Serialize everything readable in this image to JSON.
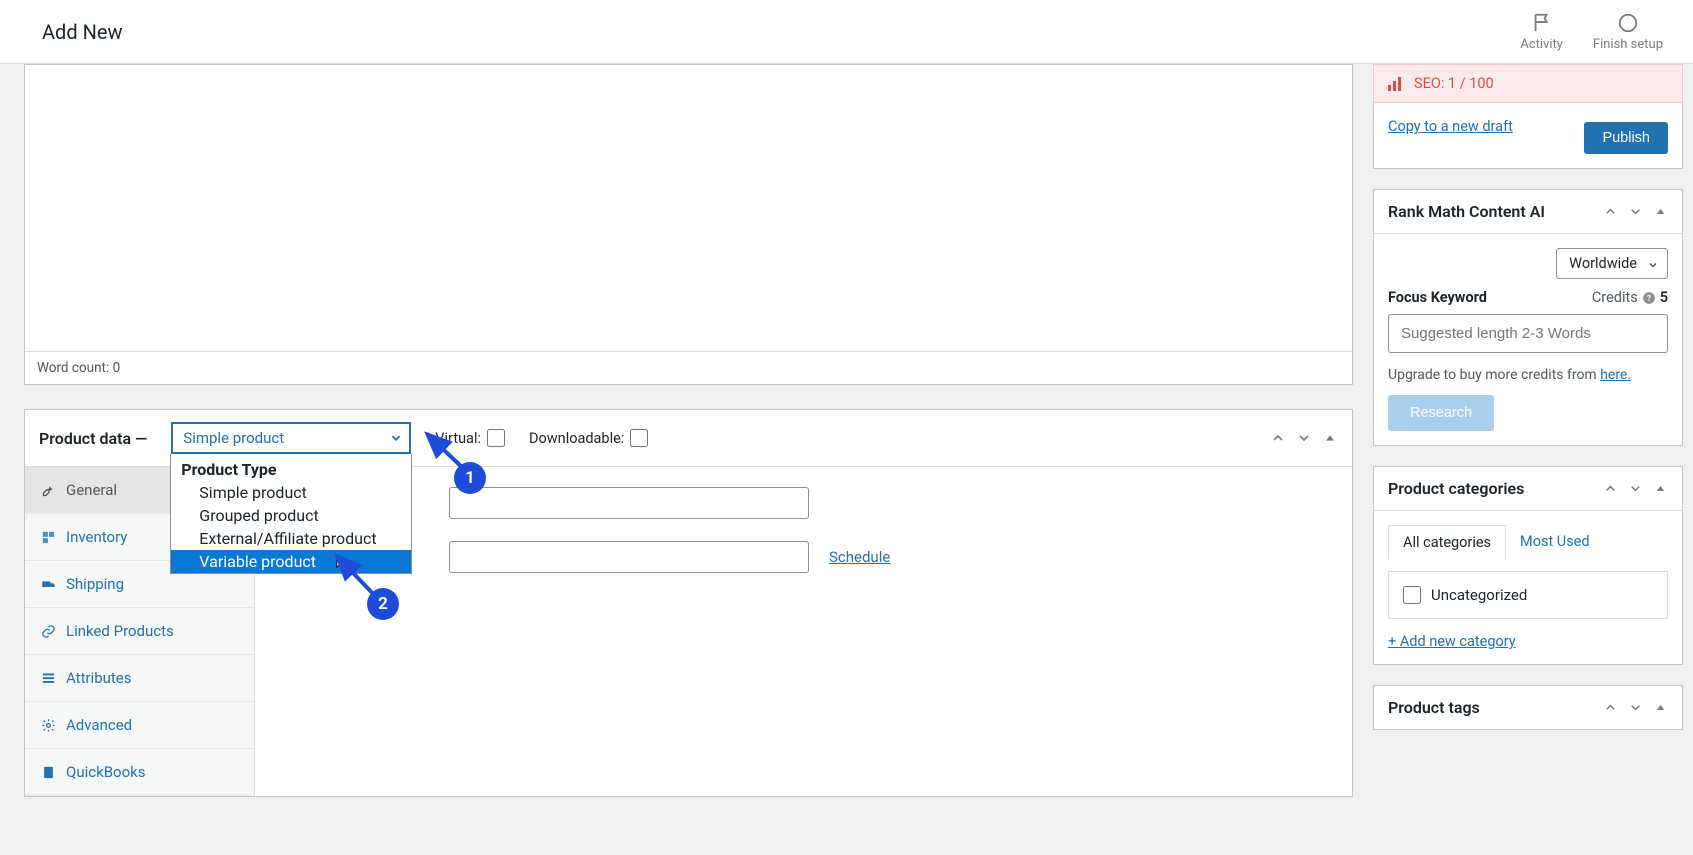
{
  "topbar": {
    "title": "Add New",
    "activity": "Activity",
    "finish": "Finish setup"
  },
  "editor": {
    "word_count": "Word count: 0"
  },
  "product_data": {
    "title": "Product data —",
    "selected": "Simple product",
    "group_label": "Product Type",
    "options": [
      "Simple product",
      "Grouped product",
      "External/Affiliate product",
      "Variable product"
    ],
    "virtual_label": "Virtual:",
    "downloadable_label": "Downloadable:",
    "tabs": {
      "general": "General",
      "inventory": "Inventory",
      "shipping": "Shipping",
      "linked": "Linked Products",
      "attributes": "Attributes",
      "advanced": "Advanced",
      "quickbooks": "QuickBooks"
    },
    "schedule": "Schedule"
  },
  "annotations": {
    "one": "1",
    "two": "2"
  },
  "publish": {
    "seo": "SEO: 1 / 100",
    "copy": "Copy to a new draft",
    "button": "Publish"
  },
  "rankmath": {
    "title": "Rank Math Content AI",
    "worldwide": "Worldwide",
    "focus": "Focus Keyword",
    "credits_label": "Credits",
    "credits_value": "5",
    "placeholder": "Suggested length 2-3 Words",
    "upgrade_prefix": "Upgrade to buy more credits from ",
    "upgrade_link": "here.",
    "research": "Research"
  },
  "categories": {
    "title": "Product categories",
    "all": "All categories",
    "most_used": "Most Used",
    "uncategorized": "Uncategorized",
    "add_new": "+ Add new category"
  },
  "tags": {
    "title": "Product tags"
  }
}
